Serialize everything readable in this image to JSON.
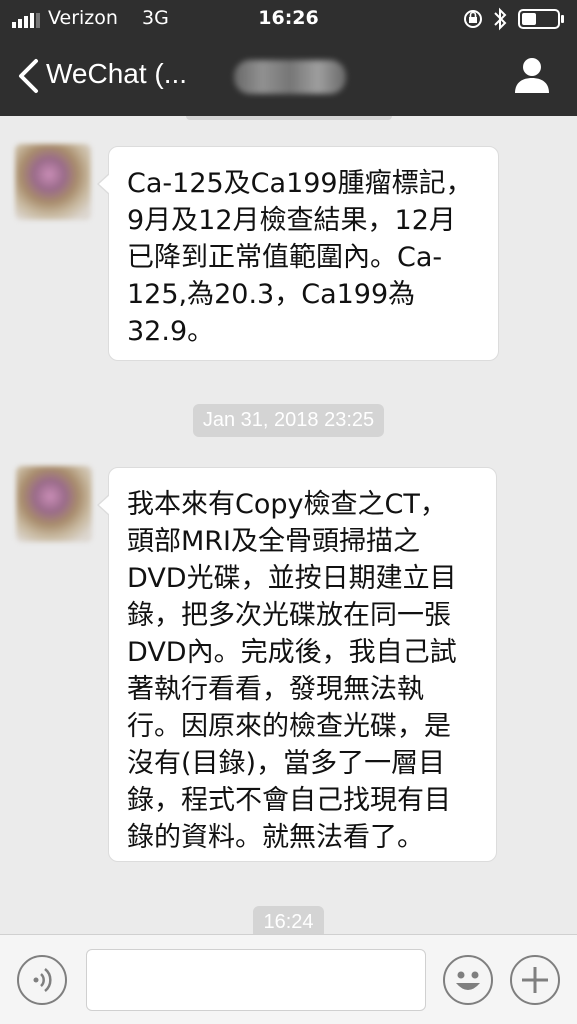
{
  "status_bar": {
    "carrier": "Verizon",
    "network": "3G",
    "time": "16:26"
  },
  "nav": {
    "title": "WeChat (...",
    "icons": {
      "back": "chevron-left-icon",
      "profile": "user-icon"
    }
  },
  "messages": [
    {
      "type": "text",
      "text": "Ca-125及Ca199腫瘤標記，\n9月及12月檢查結果，12月\n已降到正常值範圍內。Ca-\n125,為20.3，Ca199為\n32.9。"
    },
    {
      "type": "timestamp",
      "text": "Jan 31, 2018 23:25"
    },
    {
      "type": "text",
      "text": "我本來有Copy檢查之CT，\n頭部MRI及全骨頭掃描之\nDVD光碟，並按日期建立目\n錄，把多次光碟放在同一張\nDVD內。完成後，我自己試\n著執行看看，發現無法執\n行。因原來的檢查光碟，是\n沒有(目錄)，當多了一層目\n錄，程式不會自己找現有目\n錄的資料。就無法看了。"
    },
    {
      "type": "timestamp",
      "text": "16:24"
    }
  ],
  "input_bar": {
    "icons": [
      "voice-icon",
      "emoji-icon",
      "plus-icon"
    ],
    "input_value": ""
  },
  "colors": {
    "nav_bg": "#2f2f2f",
    "chat_bg": "#ebebeb",
    "bubble_bg": "#ffffff",
    "timestamp_bg": "#d4d4d4"
  }
}
